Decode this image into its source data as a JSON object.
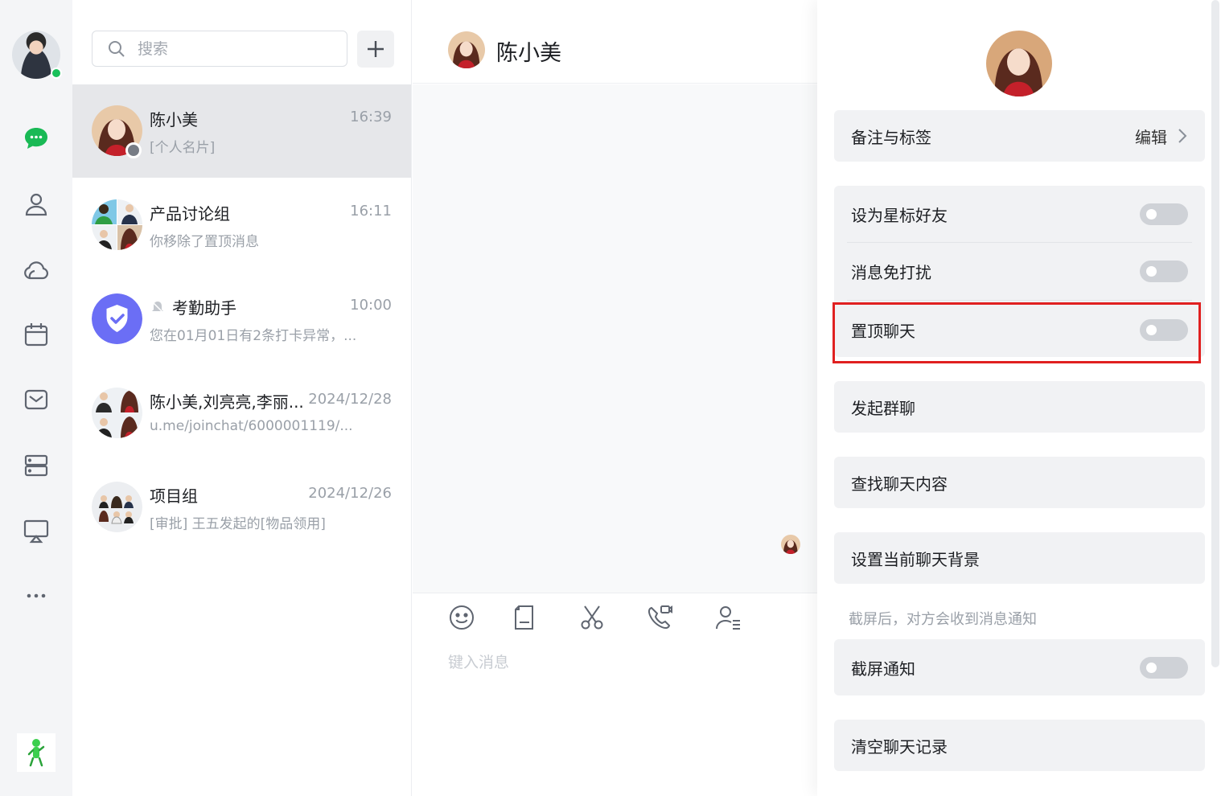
{
  "rail": {
    "items": [
      {
        "name": "chat-icon",
        "active": true
      },
      {
        "name": "contacts-icon"
      },
      {
        "name": "cloud-icon"
      },
      {
        "name": "calendar-icon"
      },
      {
        "name": "mail-icon"
      },
      {
        "name": "database-icon"
      },
      {
        "name": "screen-share-icon"
      },
      {
        "name": "more-icon"
      }
    ],
    "colors": {
      "active": "#19b955",
      "idle": "#5f6570",
      "online": "#19c05a"
    }
  },
  "search": {
    "placeholder": "搜索"
  },
  "conversations": [
    {
      "name": "陈小美",
      "time": "16:39",
      "preview": "[个人名片]"
    },
    {
      "name": "产品讨论组",
      "time": "16:11",
      "preview": "你移除了置顶消息"
    },
    {
      "name": "考勤助手",
      "time": "10:00",
      "preview": "您在01月01日有2条打卡异常，..."
    },
    {
      "name": "陈小美,刘亮亮,李丽...",
      "time": "2024/12/28",
      "preview": "u.me/joinchat/6000001119/..."
    },
    {
      "name": "项目组",
      "time": "2024/12/26",
      "preview": "[审批] 王五发起的[物品领用]"
    }
  ],
  "chat": {
    "title": "陈小美",
    "input_placeholder": "键入消息",
    "tools": [
      "emoji-icon",
      "file-icon",
      "scissors-icon",
      "video-call-icon",
      "add-contact-icon"
    ]
  },
  "panel": {
    "remark": {
      "label": "备注与标签",
      "action": "编辑"
    },
    "star": {
      "label": "设为星标好友",
      "on": false
    },
    "mute": {
      "label": "消息免打扰",
      "on": false
    },
    "pin": {
      "label": "置顶聊天",
      "on": false
    },
    "group": {
      "label": "发起群聊"
    },
    "find": {
      "label": "查找聊天内容"
    },
    "background": {
      "label": "设置当前聊天背景"
    },
    "screenshot_hint": "截屏后，对方会收到消息通知",
    "screenshot": {
      "label": "截屏通知",
      "on": false
    },
    "clear": {
      "label": "清空聊天记录"
    }
  },
  "accent": {
    "highlight": "#e02020",
    "assistant": "#6b6ef5"
  }
}
